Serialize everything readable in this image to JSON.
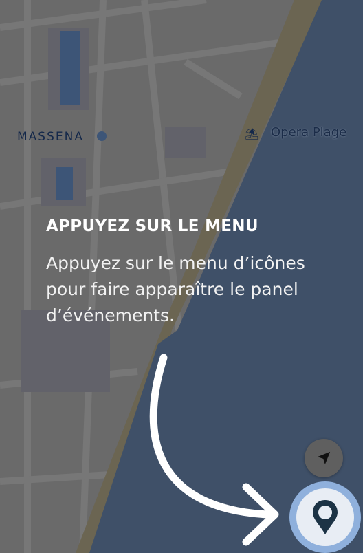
{
  "map": {
    "labels": {
      "district": "MASSENA",
      "beach": "Opera Plage"
    },
    "icons": {
      "beach": "beach-umbrella-icon",
      "locate": "navigation-arrow-icon",
      "menu": "map-pin-icon"
    },
    "colors": {
      "land": "#6a6a6a",
      "sea": "#3f5068",
      "beach": "#6b6552",
      "menu_ring": "#8fb0dc"
    }
  },
  "tooltip": {
    "title": "APPUYEZ SUR LE MENU",
    "body": "Appuyez sur le menu d’icônes pour faire apparaître le panel d’événements."
  }
}
